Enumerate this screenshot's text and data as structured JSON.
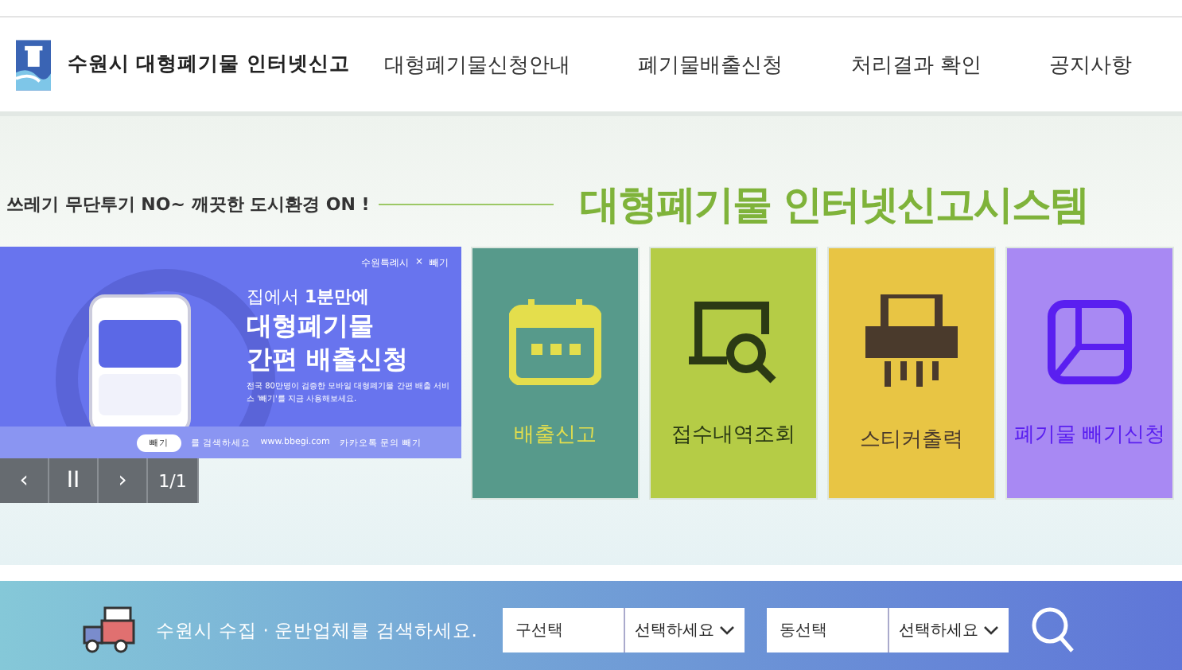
{
  "header": {
    "logo_text": "수원시 대형폐기물 인터넷신고",
    "nav": [
      {
        "label": "대형폐기물신청안내",
        "selected": false
      },
      {
        "label": "폐기물배출신청",
        "selected": false
      },
      {
        "label": "처리결과 확인",
        "selected": false
      },
      {
        "label": "공지사항",
        "selected": false
      }
    ]
  },
  "slogan": {
    "text": "쓰레기 무단투기 NO~ 깨끗한 도시환경 **ON !**",
    "title": "대형폐기물 인터넷신고시스템"
  },
  "banner": {
    "partner": "수원특례시",
    "times": "×",
    "brand": "빼기",
    "kicker": "집에서 **1분만에**",
    "headline": [
      "대형폐기물",
      "간편 배출신청"
    ],
    "description": "전국 80만명이 검증한 모바일 대형폐기물 간편 배출 서비스 '빼기'를 지금 사용해보세요.",
    "search_chip": "빼기",
    "search_hint": "를 검색하세요",
    "site": "www.bbegi.com",
    "kakao": "카카오톡 문의 빼기",
    "controls": {
      "prev": "‹",
      "pause": "II",
      "next": "›",
      "page": "1/1"
    }
  },
  "tiles": [
    {
      "kind": "calendar",
      "label": "배출신고",
      "color": "#579a8b"
    },
    {
      "kind": "search",
      "label": "접수내역조회",
      "color": "#b5cc46"
    },
    {
      "kind": "printer",
      "label": "스티커출력",
      "color": "#e8c544"
    },
    {
      "kind": "frame",
      "label": "폐기물 빼기신청",
      "color": "#a889f3"
    }
  ],
  "search_bar": {
    "text": "수원시 수집 · 운반업체를 검색하세요.",
    "filters": [
      {
        "label": "구선택",
        "value": "선택하세요"
      },
      {
        "label": "동선택",
        "value": "선택하세요"
      }
    ]
  }
}
